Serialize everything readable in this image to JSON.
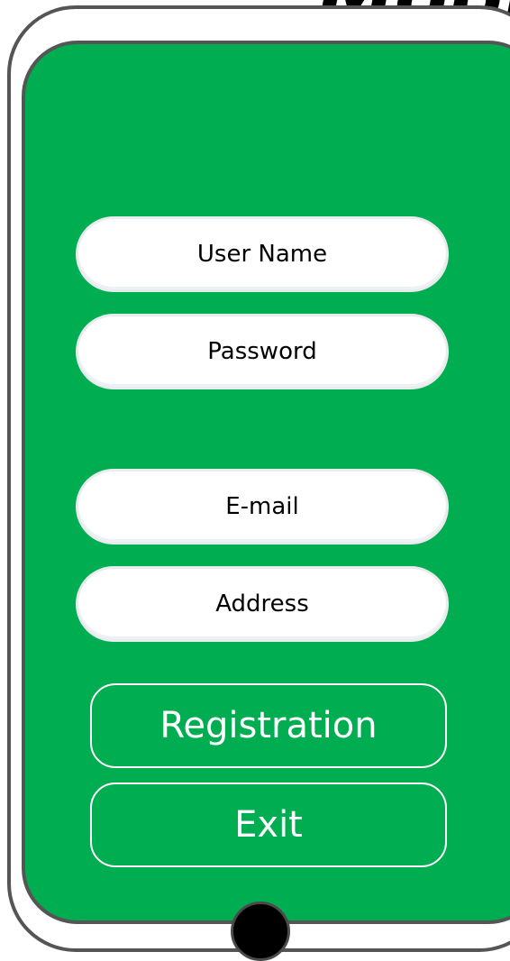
{
  "header": {
    "title": "Mobi"
  },
  "form": {
    "fields": [
      {
        "label": "User Name"
      },
      {
        "label": "Password"
      },
      {
        "label": "E-mail"
      },
      {
        "label": "Address"
      }
    ]
  },
  "actions": {
    "registration_label": "Registration",
    "exit_label": "Exit"
  },
  "colors": {
    "screen": "#00ad50",
    "frame": "#555555",
    "field": "#ffffff",
    "button_text": "#ffffff"
  },
  "icons": {
    "home": "home-button-icon"
  }
}
